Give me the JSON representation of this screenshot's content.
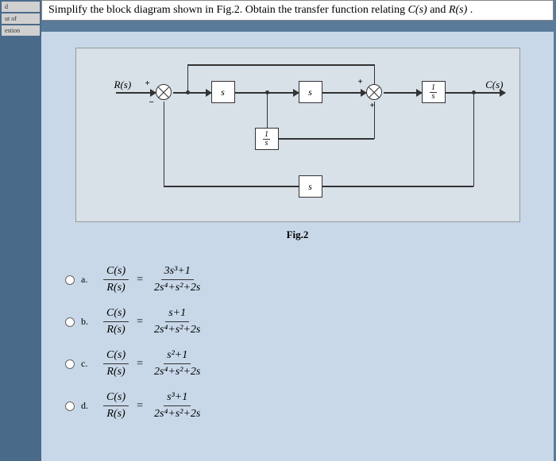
{
  "sidebar": {
    "items": [
      "d",
      "ut of",
      "estion"
    ]
  },
  "question": {
    "text_prefix": "Simplify the block diagram shown in Fig.2. Obtain the transfer function relating ",
    "cs": "C(s)",
    "between": " and ",
    "rs": "R(s)",
    "suffix": "."
  },
  "diagram": {
    "input_label": "R(s)",
    "output_label": "C(s)",
    "block1": "s",
    "block2": "s",
    "block3_num": "1",
    "block3_den": "s",
    "feedback_inner_num": "1",
    "feedback_inner_den": "s",
    "feedback_outer": "s",
    "caption": "Fig.2",
    "sign_plus1": "+",
    "sign_minus1": "−",
    "sign_plus2": "+",
    "sign_plus3": "+"
  },
  "options": [
    {
      "label": "a.",
      "lhs_top": "C(s)",
      "lhs_bot": "R(s)",
      "rhs_top": "3s³+1",
      "rhs_bot": "2s⁴+s²+2s"
    },
    {
      "label": "b.",
      "lhs_top": "C(s)",
      "lhs_bot": "R(s)",
      "rhs_top": "s+1",
      "rhs_bot": "2s⁴+s²+2s"
    },
    {
      "label": "c.",
      "lhs_top": "C(s)",
      "lhs_bot": "R(s)",
      "rhs_top": "s²+1",
      "rhs_bot": "2s⁴+s²+2s"
    },
    {
      "label": "d.",
      "lhs_top": "C(s)",
      "lhs_bot": "R(s)",
      "rhs_top": "s³+1",
      "rhs_bot": "2s⁴+s²+2s"
    }
  ]
}
